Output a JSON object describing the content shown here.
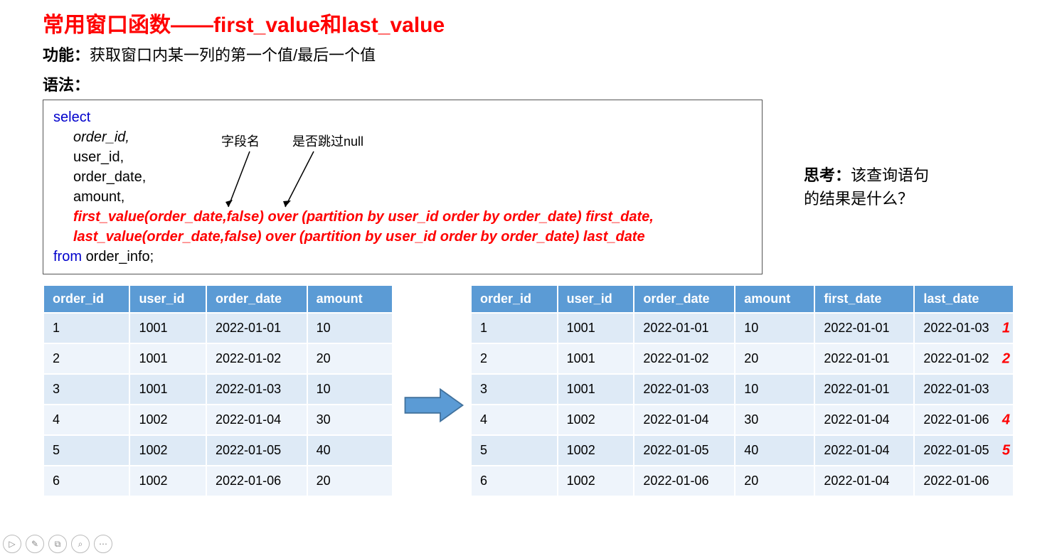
{
  "title": "常用窗口函数——first_value和last_value",
  "function_line": {
    "label": "功能：",
    "text": "获取窗口内某一列的第一个值/最后一个值"
  },
  "syntax_label": "语法：",
  "sql": {
    "select_kw": "select",
    "col_order_id": "order_id",
    "col_user_id": "user_id",
    "col_order_date": "order_date",
    "col_amount": "amount",
    "first_value_line": "first_value(order_date,false) over (partition by user_id order by order_date) first_date,",
    "last_value_line": "last_value(order_date,false) over (partition by user_id order by order_date) last_date",
    "from_kw": "from",
    "table": "order_info;"
  },
  "annotations": {
    "field_name": "字段名",
    "skip_null": "是否跳过null"
  },
  "think": {
    "label": "思考：",
    "text1": "该查询语句",
    "text2": "的结果是什么？"
  },
  "left_table": {
    "headers": [
      "order_id",
      "user_id",
      "order_date",
      "amount"
    ],
    "rows": [
      [
        "1",
        "1001",
        "2022-01-01",
        "10"
      ],
      [
        "2",
        "1001",
        "2022-01-02",
        "20"
      ],
      [
        "3",
        "1001",
        "2022-01-03",
        "10"
      ],
      [
        "4",
        "1002",
        "2022-01-04",
        "30"
      ],
      [
        "5",
        "1002",
        "2022-01-05",
        "40"
      ],
      [
        "6",
        "1002",
        "2022-01-06",
        "20"
      ]
    ]
  },
  "right_table": {
    "headers": [
      "order_id",
      "user_id",
      "order_date",
      "amount",
      "first_date",
      "last_date"
    ],
    "rows": [
      [
        "1",
        "1001",
        "2022-01-01",
        "10",
        "2022-01-01",
        "2022-01-03"
      ],
      [
        "2",
        "1001",
        "2022-01-02",
        "20",
        "2022-01-01",
        "2022-01-02"
      ],
      [
        "3",
        "1001",
        "2022-01-03",
        "10",
        "2022-01-01",
        "2022-01-03"
      ],
      [
        "4",
        "1002",
        "2022-01-04",
        "30",
        "2022-01-04",
        "2022-01-06"
      ],
      [
        "5",
        "1002",
        "2022-01-05",
        "40",
        "2022-01-04",
        "2022-01-05"
      ],
      [
        "6",
        "1002",
        "2022-01-06",
        "20",
        "2022-01-04",
        "2022-01-06"
      ]
    ],
    "overlays": [
      "1",
      "2",
      "",
      "4",
      "5",
      ""
    ]
  },
  "toolbar": {
    "play": "▷",
    "edit": "✎",
    "copy": "⧉",
    "zoom": "⌕",
    "more": "⋯"
  }
}
